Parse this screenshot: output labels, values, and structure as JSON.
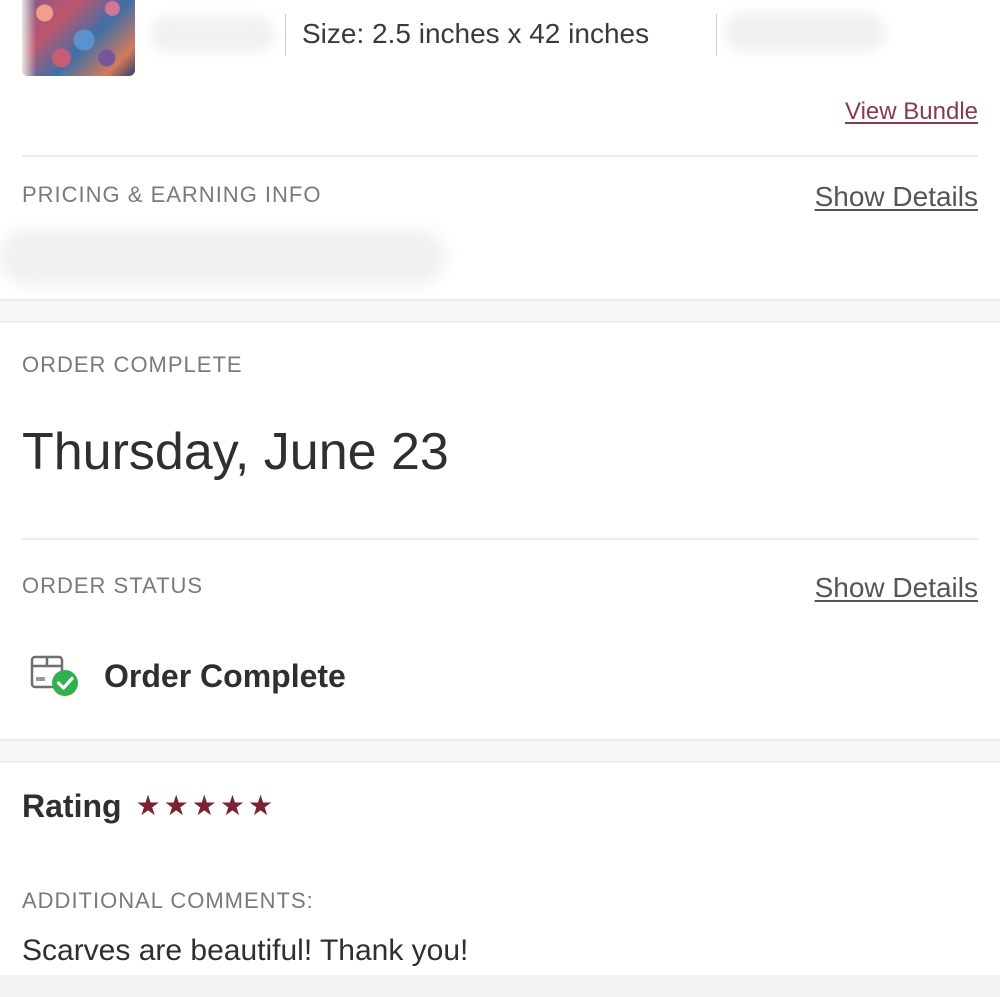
{
  "item": {
    "size_text": "Size: 2.5 inches x 42 inches",
    "view_bundle_label": "View Bundle"
  },
  "pricing": {
    "label": "PRICING & EARNING INFO",
    "show_details_label": "Show Details"
  },
  "order_complete": {
    "label": "ORDER COMPLETE",
    "date": "Thursday, June 23"
  },
  "order_status": {
    "label": "ORDER STATUS",
    "show_details_label": "Show Details",
    "status_text": "Order Complete",
    "icon": "package-check-icon"
  },
  "rating": {
    "title": "Rating",
    "stars": 5,
    "star_color": "#7a2230"
  },
  "comments": {
    "label": "ADDITIONAL COMMENTS:",
    "text": "Scarves are beautiful! Thank you!"
  },
  "colors": {
    "link_accent": "#8a3a4a",
    "status_green": "#2fb04a"
  }
}
